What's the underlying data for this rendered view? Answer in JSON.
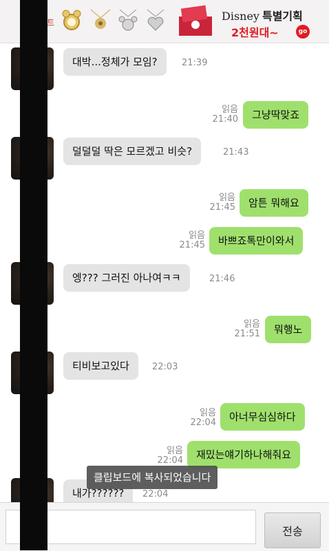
{
  "ad": {
    "tag": "이벤트",
    "brand": "Disney",
    "brand_sub": "특별기획",
    "price": "2천원대~",
    "go": "go"
  },
  "messages": [
    {
      "dir": "in",
      "text": "대박...정체가 모임?",
      "time": "21:39"
    },
    {
      "dir": "out",
      "text": "그냥딱맞죠",
      "read": "읽음",
      "time": "21:40"
    },
    {
      "dir": "in",
      "text": "덜덜덜 딱은 모르겠고 비슷?",
      "time": "21:43"
    },
    {
      "dir": "out",
      "text": "암튼 뭐해요",
      "read": "읽음",
      "time": "21:45"
    },
    {
      "dir": "out",
      "text": "바쁘죠톡만이와서",
      "read": "읽음",
      "time": "21:45"
    },
    {
      "dir": "in",
      "text": "엥??? 그러진 아나여ㅋㅋ",
      "time": "21:46"
    },
    {
      "dir": "out",
      "text": "뭐행노",
      "read": "읽음",
      "time": "21:51"
    },
    {
      "dir": "in",
      "text": "티비보고있다",
      "time": "22:03"
    },
    {
      "dir": "out",
      "text": "아너무심심하다",
      "read": "읽음",
      "time": "22:04"
    },
    {
      "dir": "out",
      "text": "재밌는얘기하나해줘요",
      "read": "읽음",
      "time": "22:04"
    },
    {
      "dir": "in",
      "text": "내가??????",
      "time": "22:04"
    }
  ],
  "toast": "클립보드에 복사되었습니다",
  "input": {
    "value": "",
    "send_label": "전송"
  }
}
